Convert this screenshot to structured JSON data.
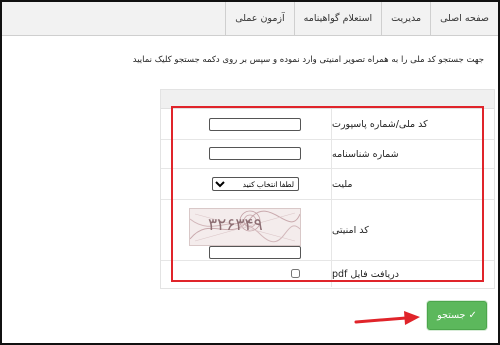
{
  "nav": {
    "items": [
      {
        "label": "صفحه اصلی"
      },
      {
        "label": "مدیریت"
      },
      {
        "label": "استعلام گواهینامه"
      },
      {
        "label": "آزمون عملی"
      }
    ]
  },
  "instruction": "جهت جستجو کد ملی را به همراه تصویر امنیتی وارد نموده و سپس بر روی دکمه جستجو کلیک نمایید",
  "form": {
    "national_id_label": "کد ملی/شماره پاسپورت",
    "national_id_value": "",
    "birth_cert_label": "شماره شناسنامه",
    "birth_cert_value": "",
    "nationality_label": "ملیت",
    "nationality_selected": "لطفا انتخاب کنید",
    "captcha_label": "کد امنیتی",
    "captcha_text": "۳۲۶۳۴۹",
    "captcha_value": "",
    "pdf_label": "دریافت فایل pdf",
    "pdf_checked": false
  },
  "search_button": {
    "label": "جستجو",
    "icon": "check-icon"
  },
  "colors": {
    "highlight": "#e0242a",
    "button_bg": "#5cb85c",
    "nav_bg": "#f2f2f2"
  }
}
